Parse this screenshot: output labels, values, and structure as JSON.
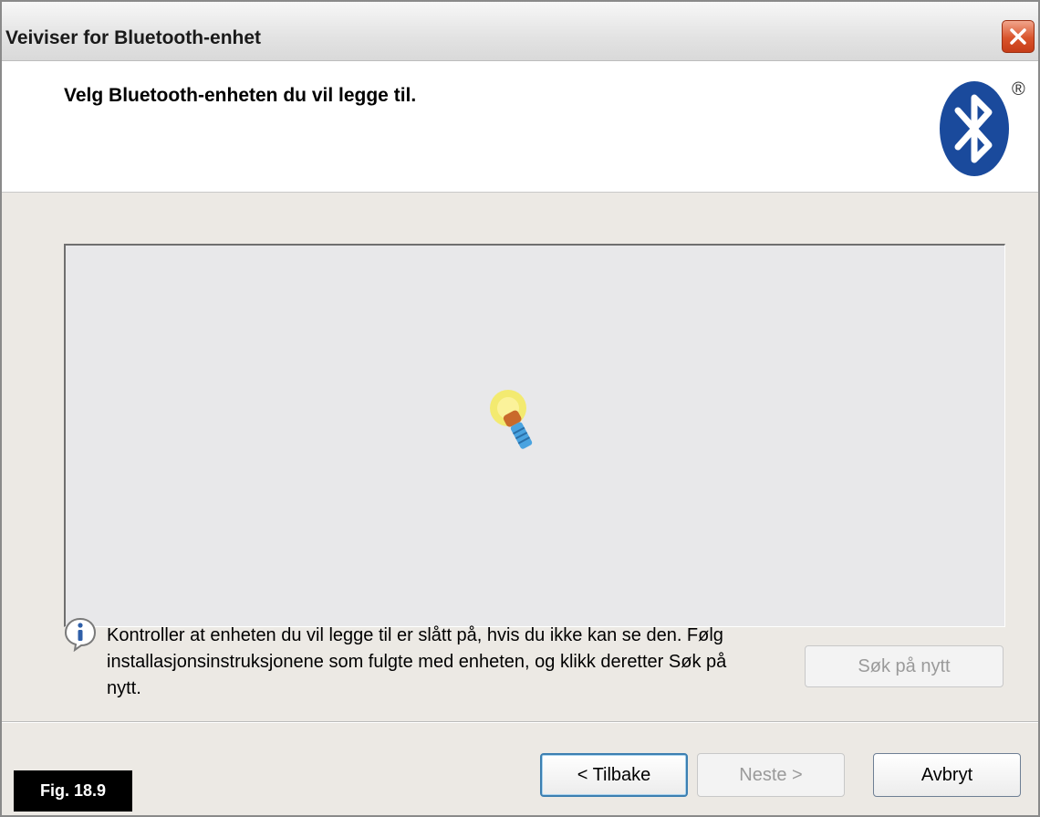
{
  "window": {
    "title": "Veiviser for Bluetooth-enhet"
  },
  "header": {
    "heading": "Velg Bluetooth-enheten du vil legge til.",
    "logo_mark": "®"
  },
  "device_list": {
    "state_icon": "searching-flashlight-icon"
  },
  "info": {
    "icon": "info-icon",
    "text": "Kontroller at enheten du vil legge til er slått på, hvis du ikke kan se den. Følg installasjonsinstruksjonene som fulgte med enheten, og klikk deretter Søk på nytt."
  },
  "buttons": {
    "search_again": "Søk på nytt",
    "back": "< Tilbake",
    "next": "Neste >",
    "cancel": "Avbryt"
  },
  "figure_label": "Fig. 18.9",
  "colors": {
    "close_button": "#d9542c",
    "bluetooth_blue": "#1a4a9c",
    "focus_border": "#3c7fb1"
  }
}
